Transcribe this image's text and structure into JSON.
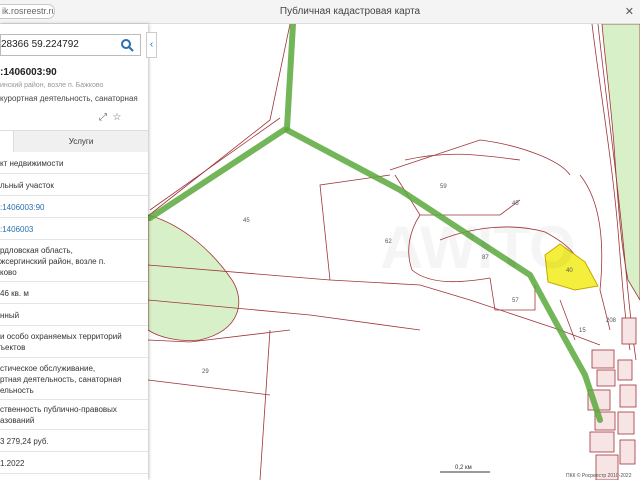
{
  "url": "ik.rosreestr.ru",
  "window_title": "Публичная кадастровая карта",
  "search": {
    "value": "28366 59.224792"
  },
  "object": {
    "number": ":1406003:90",
    "sub": "инский район, возле п. Бажково",
    "desc": "курортная деятельность, санаторная",
    "desc2": ""
  },
  "tabs": [
    {
      "label": ""
    },
    {
      "label": "Услуги"
    }
  ],
  "rows": [
    {
      "text": "кт недвижимости",
      "link": false
    },
    {
      "text": "льный участок",
      "link": false
    },
    {
      "text": ":1406003:90",
      "link": true
    },
    {
      "text": ":1406003",
      "link": true
    },
    {
      "text": "рдловская область,\nжсергинский район, возле п.\nково",
      "link": false
    },
    {
      "text": "46 кв. м",
      "link": false
    },
    {
      "text": "нный",
      "link": false
    },
    {
      "text": "и особо охраняемых территорий\nъектов",
      "link": false
    },
    {
      "text": "стическое обслуживание,\nртная деятельность, санаторная\nельность",
      "link": false
    },
    {
      "text": "ственность публично-правовых\nазований",
      "link": false
    },
    {
      "text": "3 279,24 руб.",
      "link": false
    },
    {
      "text": "1.2022",
      "link": false
    }
  ],
  "map": {
    "parcel_labels": [
      "45",
      "59",
      "45",
      "62",
      "87",
      "40",
      "57",
      "208",
      "29",
      "15"
    ],
    "scale": "0,2 км",
    "copyright": "ПКК © Росреестр 2010-2022"
  },
  "colors": {
    "accent": "#2a6fb0",
    "boundary": "#a0343a",
    "road": "#5aa83c",
    "green": "#d8f0c8",
    "selected": "#f3ef3c"
  }
}
